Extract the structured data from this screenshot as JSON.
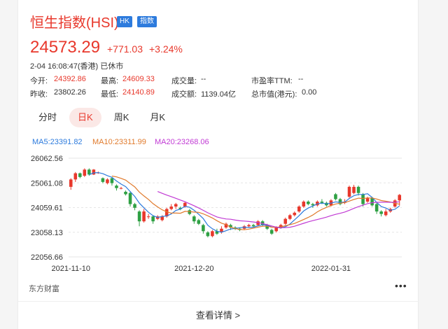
{
  "header": {
    "title": "恒生指数(HSI)",
    "badge_market": "HK",
    "badge_type": "指数",
    "price": "24573.29",
    "change": "+771.03",
    "change_pct": "+3.24%",
    "timestamp": "2-04 16:08:47(香港) 已休市"
  },
  "fields": {
    "open_label": "今开:",
    "open_value": "24392.86",
    "high_label": "最高:",
    "high_value": "24609.33",
    "volume_label": "成交量:",
    "volume_value": "--",
    "pe_label": "市盈率TTM:",
    "pe_value": "--",
    "prev_label": "昨收:",
    "prev_value": "23802.26",
    "low_label": "最低:",
    "low_value": "24140.89",
    "amount_label": "成交额:",
    "amount_value": "1139.04亿",
    "mktcap_label": "总市值(港元):",
    "mktcap_value": "0.00"
  },
  "tabs": [
    "分时",
    "日K",
    "周K",
    "月K"
  ],
  "active_tab": "日K",
  "ma": {
    "ma5": "MA5:23391.82",
    "ma10": "MA10:23311.99",
    "ma20": "MA20:23268.06"
  },
  "colors": {
    "up": "#e8382c",
    "down": "#2ea043",
    "ma5": "#2d7bdd",
    "ma10": "#e07a2c",
    "ma20": "#c13ad4",
    "badge": "#2d7bdd"
  },
  "footer": {
    "source": "东方财富",
    "more_icon": "ellipsis-icon",
    "details": "查看详情 >"
  },
  "chart_data": {
    "type": "candlestick",
    "yticks": [
      "26062.56",
      "25061.08",
      "24059.61",
      "23058.13",
      "22056.66"
    ],
    "ylim": [
      22056.66,
      26062.56
    ],
    "xticks": [
      {
        "label": "2021-11-10",
        "index": 0
      },
      {
        "label": "2021-12-20",
        "index": 27
      },
      {
        "label": "2022-01-31",
        "index": 57
      }
    ],
    "candles": [
      [
        24900,
        25200,
        25250,
        24780
      ],
      [
        25200,
        25450,
        25500,
        25100
      ],
      [
        25450,
        25300,
        25480,
        25250
      ],
      [
        25350,
        25600,
        25650,
        25300
      ],
      [
        25600,
        25400,
        25650,
        25350
      ],
      [
        25400,
        25600,
        25620,
        25380
      ],
      [
        25450,
        25480,
        25520,
        25430
      ],
      [
        25250,
        25100,
        25280,
        25050
      ],
      [
        25050,
        25200,
        25250,
        25000
      ],
      [
        25250,
        25050,
        25300,
        24950
      ],
      [
        24950,
        24850,
        25000,
        24750
      ],
      [
        24850,
        24850,
        24900,
        24800
      ],
      [
        24700,
        24600,
        24750,
        24550
      ],
      [
        24650,
        24200,
        24700,
        24100
      ],
      [
        24200,
        24050,
        24250,
        23950
      ],
      [
        23900,
        23500,
        23950,
        23300
      ],
      [
        23500,
        23900,
        24000,
        23450
      ],
      [
        23700,
        23700,
        23800,
        23600
      ],
      [
        23700,
        23500,
        23750,
        23400
      ],
      [
        23600,
        23700,
        23750,
        23550
      ],
      [
        23550,
        23700,
        23750,
        23500
      ],
      [
        23700,
        24000,
        24050,
        23650
      ],
      [
        24000,
        24100,
        24200,
        23950
      ],
      [
        24100,
        24200,
        24250,
        24000
      ],
      [
        24050,
        24000,
        24100,
        23950
      ],
      [
        24100,
        24250,
        24300,
        24050
      ],
      [
        23950,
        23800,
        24000,
        23750
      ],
      [
        23700,
        23500,
        23750,
        23400
      ],
      [
        23550,
        23400,
        23600,
        23350
      ],
      [
        23350,
        23100,
        23400,
        23000
      ],
      [
        23050,
        22900,
        23100,
        22850
      ],
      [
        22900,
        23100,
        23150,
        22850
      ],
      [
        23100,
        23000,
        23200,
        22950
      ],
      [
        23050,
        23200,
        23300,
        23000
      ],
      [
        23250,
        23400,
        23450,
        23200
      ],
      [
        23350,
        23250,
        23400,
        23150
      ],
      [
        23250,
        23200,
        23300,
        23150
      ],
      [
        23200,
        23150,
        23250,
        23100
      ],
      [
        23200,
        23300,
        23350,
        23150
      ],
      [
        23300,
        23350,
        23400,
        23250
      ],
      [
        23350,
        23300,
        23400,
        23250
      ],
      [
        23350,
        23500,
        23550,
        23300
      ],
      [
        23500,
        23350,
        23550,
        23300
      ],
      [
        23350,
        23200,
        23400,
        23150
      ],
      [
        23150,
        23000,
        23200,
        22950
      ],
      [
        23100,
        23250,
        23300,
        23050
      ],
      [
        23250,
        23350,
        23400,
        23200
      ],
      [
        23400,
        23600,
        23650,
        23350
      ],
      [
        23600,
        23750,
        23800,
        23550
      ],
      [
        23750,
        23850,
        23900,
        23700
      ],
      [
        23900,
        24100,
        24150,
        23850
      ],
      [
        24100,
        24300,
        24350,
        24050
      ],
      [
        24300,
        24200,
        24350,
        24150
      ],
      [
        24200,
        24150,
        24250,
        24050
      ],
      [
        24150,
        24300,
        24350,
        24100
      ],
      [
        24300,
        24250,
        24400,
        24200
      ],
      [
        24250,
        24150,
        24300,
        24100
      ],
      [
        24150,
        24350,
        24400,
        24100
      ],
      [
        24600,
        24400,
        24650,
        24350
      ],
      [
        24400,
        24200,
        24450,
        24150
      ],
      [
        24250,
        24300,
        24400,
        24200
      ],
      [
        24500,
        24900,
        24950,
        24450
      ],
      [
        24650,
        24900,
        24980,
        24600
      ],
      [
        24900,
        24650,
        24950,
        24550
      ],
      [
        24600,
        24200,
        24650,
        24100
      ],
      [
        24300,
        24450,
        24500,
        24250
      ],
      [
        24450,
        24150,
        24500,
        24100
      ],
      [
        24200,
        23900,
        24250,
        23800
      ],
      [
        23900,
        23800,
        23950,
        23700
      ],
      [
        23750,
        23900,
        24000,
        23700
      ],
      [
        23900,
        24000,
        24050,
        23850
      ],
      [
        24100,
        24350,
        24400,
        24050
      ],
      [
        24350,
        24573.29,
        24609.33,
        24140.89
      ]
    ]
  }
}
